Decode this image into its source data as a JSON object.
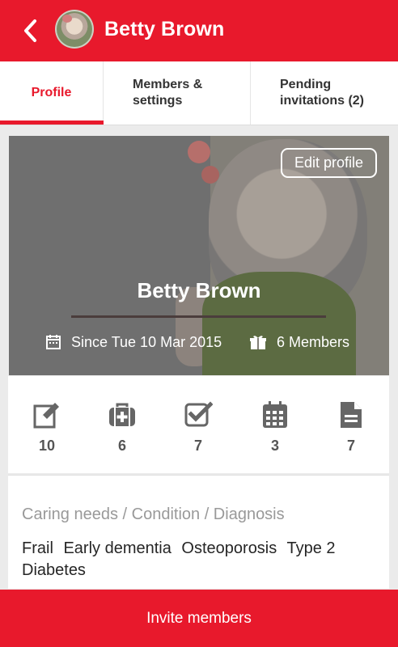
{
  "header": {
    "title": "Betty Brown"
  },
  "tabs": [
    {
      "label": "Profile",
      "active": true
    },
    {
      "label_line1": "Members &",
      "label_line2": "settings",
      "active": false
    },
    {
      "label_line1": "Pending",
      "label_line2": "invitations (2)",
      "active": false
    }
  ],
  "hero": {
    "edit_label": "Edit profile",
    "name": "Betty Brown",
    "since": "Since Tue 10 Mar 2015",
    "members": "6 Members"
  },
  "stats": [
    {
      "icon": "edit-icon",
      "value": "10"
    },
    {
      "icon": "medical-kit-icon",
      "value": "6"
    },
    {
      "icon": "checkbox-icon",
      "value": "7"
    },
    {
      "icon": "calendar-icon",
      "value": "3"
    },
    {
      "icon": "document-icon",
      "value": "7"
    }
  ],
  "needs": {
    "title": "Caring needs / Condition / Diagnosis",
    "tags": [
      "Frail",
      "Early dementia",
      "Osteoporosis",
      "Type 2",
      "Diabetes"
    ]
  },
  "footer": {
    "invite_label": "Invite members"
  },
  "colors": {
    "brand_red": "#e8192c",
    "icon_gray": "#666666"
  }
}
